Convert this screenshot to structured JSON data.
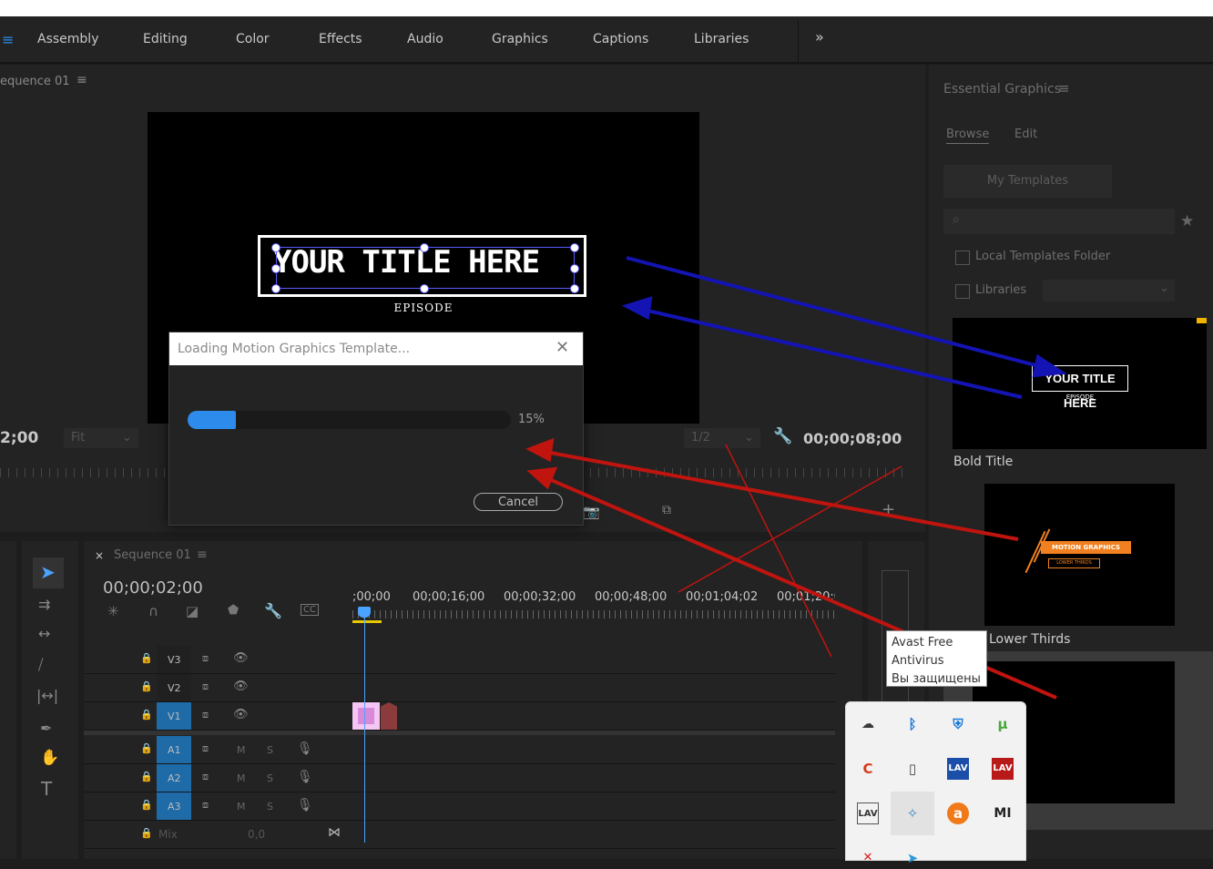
{
  "workspace": {
    "menu_icon": "hamburger-icon",
    "tabs": [
      "Assembly",
      "Editing",
      "Color",
      "Effects",
      "Audio",
      "Graphics",
      "Captions",
      "Libraries"
    ],
    "overflow_label": "»"
  },
  "program": {
    "panel_title": "equence 01",
    "timecode_left": "2;00",
    "fit_label": "Fit",
    "quality_label": "1/2",
    "timecode_right": "00;00;08;00",
    "title_text": "YOUR TITLE HERE",
    "episode_text": "EPISODE"
  },
  "dialog": {
    "title": "Loading Motion Graphics Template...",
    "progress": 0.15,
    "percent_label": "15%",
    "cancel_label": "Cancel",
    "close_glyph": "✕"
  },
  "essential_graphics": {
    "panel_title": "Essential Graphics",
    "tabs": [
      "Browse",
      "Edit"
    ],
    "my_templates_label": "My Templates",
    "local_templates_label": "Local Templates Folder",
    "libraries_label": "Libraries",
    "templates": [
      {
        "name": "Bold Title",
        "title_text": "YOUR TITLE HERE",
        "sub_text": "EPISODE"
      },
      {
        "name": "Lower Thirds",
        "title_text": "MOTION GRAPHICS",
        "sub_text": "LOWER THIRDS"
      }
    ]
  },
  "timeline": {
    "sequence_tab": "Sequence 01",
    "close_glyph": "×",
    "timecode": "00;00;02;00",
    "ruler": [
      ";00;00",
      "00;00;16;00",
      "00;00;32;00",
      "00;00;48;00",
      "00;01;04;02",
      "00;01;20;0"
    ],
    "video_tracks": [
      "V3",
      "V2",
      "V1"
    ],
    "audio_tracks": [
      "A1",
      "A2",
      "A3"
    ],
    "mute_label": "M",
    "solo_label": "S",
    "mix_label": "Mix",
    "mix_value": "0,0"
  },
  "tooltip": {
    "line1": "Avast Free",
    "line2": "Antivirus",
    "line3": "Вы защищены"
  },
  "tray": {
    "icons": [
      "onedrive-icon",
      "bluetooth-icon",
      "defender-icon",
      "utorrent-icon",
      "ccleaner-icon",
      "usb-icon",
      "lav-audio-icon",
      "lav-red-icon",
      "lav-video-icon",
      "flower-icon",
      "avast-icon",
      "mi-icon"
    ],
    "lav_label": "LAV",
    "mi_label": "MI"
  },
  "colors": {
    "accent_blue": "#2d8ceb",
    "track_active": "#1e6ba8",
    "arrow_blue": "#1414b4",
    "arrow_red": "#c0140f"
  }
}
